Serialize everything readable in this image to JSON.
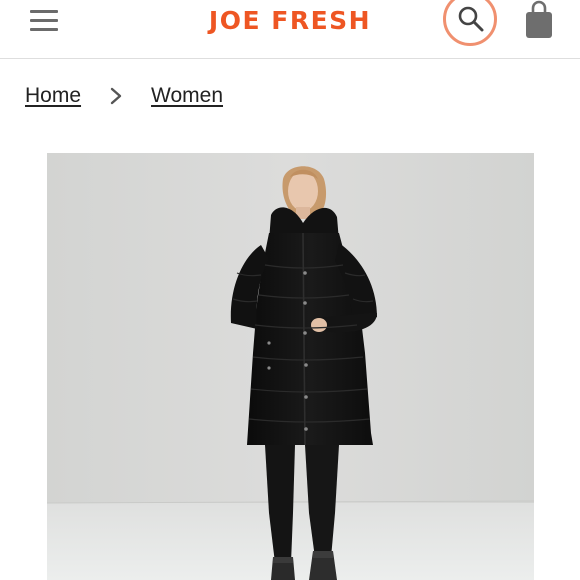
{
  "header": {
    "brand": "JOE FRESH",
    "brand_color": "#ee5623",
    "menu_icon": "hamburger-menu-icon",
    "search_icon": "search-icon",
    "cart_icon": "shopping-bag-icon"
  },
  "breadcrumb": {
    "items": [
      {
        "label": "Home"
      },
      {
        "label": "Women"
      }
    ],
    "separator_icon": "chevron-right-icon"
  },
  "product": {
    "image_alt": "Model wearing black hooded quilted puffer parka with black leggings and boots",
    "coat_color": "#101010",
    "backdrop_color": "#d6d7d6"
  }
}
